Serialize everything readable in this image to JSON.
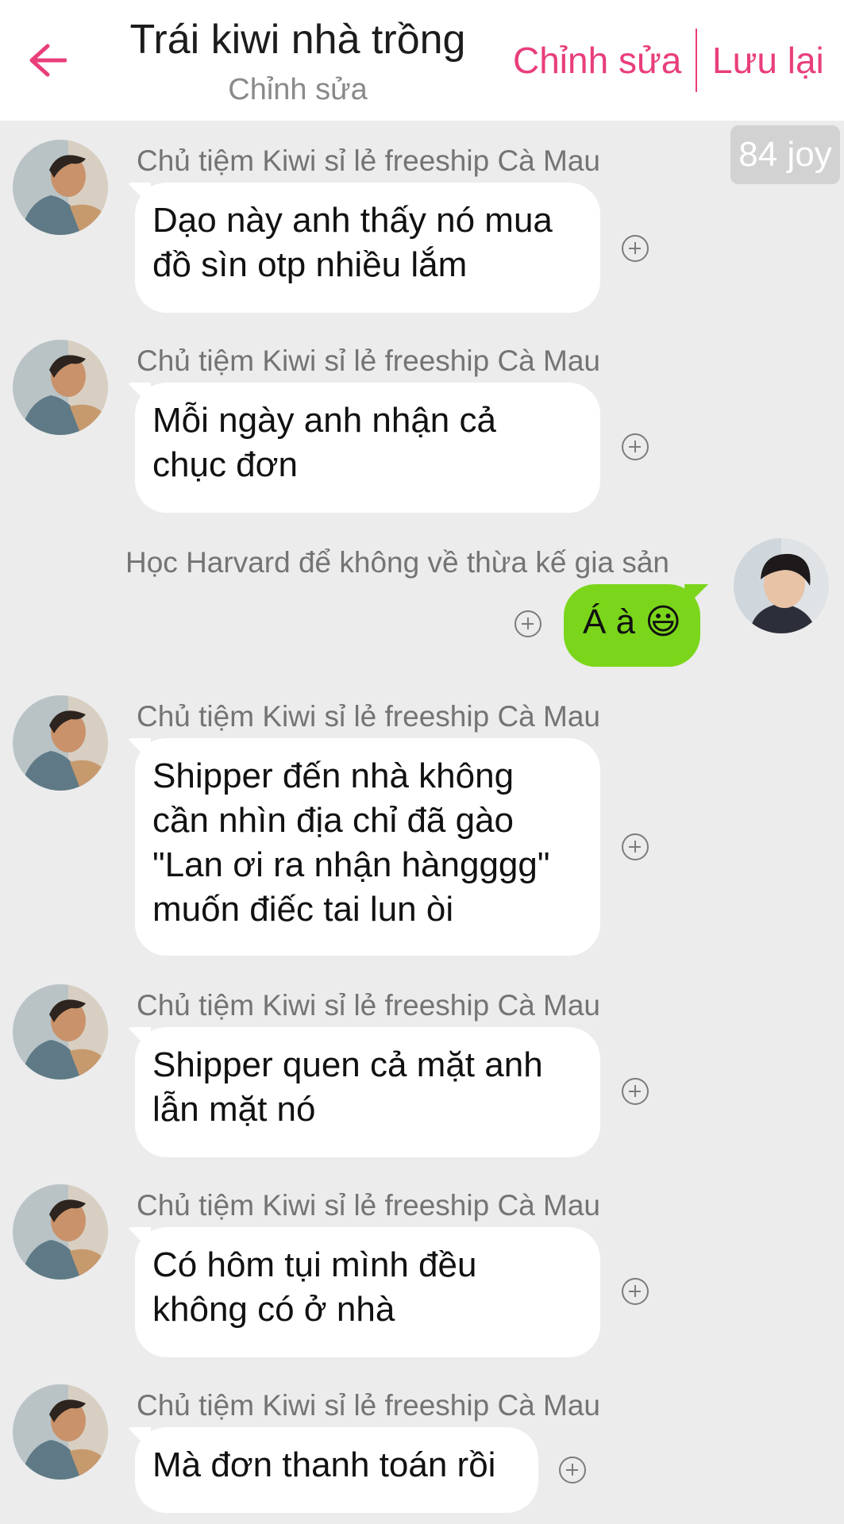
{
  "header": {
    "back_icon": "arrow-left-icon",
    "title": "Trái kiwi nhà trồng",
    "subtitle": "Chỉnh sửa",
    "edit_label": "Chỉnh sửa",
    "save_label": "Lưu lại",
    "accent_color": "#e83e7c"
  },
  "joy_badge": "84 joy",
  "messages": [
    {
      "side": "left",
      "sender": "Chủ tiệm Kiwi sỉ lẻ freeship Cà Mau",
      "text": "Dạo này anh thấy nó mua\nđồ sìn otp nhiều lắm"
    },
    {
      "side": "left",
      "sender": "Chủ tiệm Kiwi sỉ lẻ freeship Cà Mau",
      "text": "Mỗi ngày anh nhận cả\nchục đơn"
    },
    {
      "side": "right",
      "sender": "Học Harvard để không về thừa kế gia sản",
      "text": "Á à 😃"
    },
    {
      "side": "left",
      "sender": "Chủ tiệm Kiwi sỉ lẻ freeship Cà Mau",
      "text": "Shipper đến nhà không\ncần nhìn địa chỉ đã gào\n\"Lan ơi ra nhận hàngggg\"\nmuốn điếc tai lun òi"
    },
    {
      "side": "left",
      "sender": "Chủ tiệm Kiwi sỉ lẻ freeship Cà Mau",
      "text": "Shipper quen cả mặt anh\nlẫn mặt nó"
    },
    {
      "side": "left",
      "sender": "Chủ tiệm Kiwi sỉ lẻ freeship Cà Mau",
      "text": "Có hôm tụi mình đều\nkhông có ở nhà"
    },
    {
      "side": "left",
      "sender": "Chủ tiệm Kiwi sỉ lẻ freeship Cà Mau",
      "text": "Mà đơn thanh toán rồi"
    }
  ],
  "colors": {
    "background": "#ececec",
    "bubble_left": "#ffffff",
    "bubble_right": "#7bd61b",
    "sender_text": "#747474"
  }
}
